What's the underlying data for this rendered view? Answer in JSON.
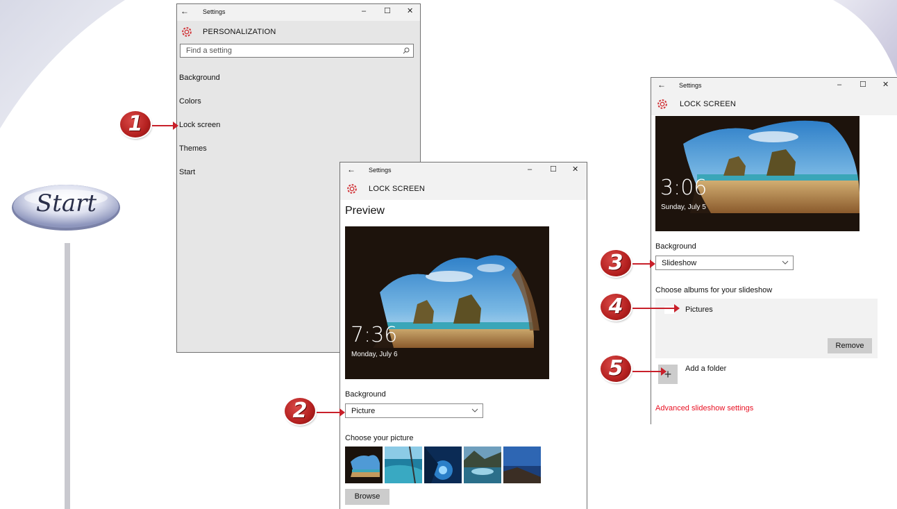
{
  "start_label": "Start",
  "win1": {
    "title": "Settings",
    "header": "PERSONALIZATION",
    "search_placeholder": "Find a setting",
    "nav": [
      "Background",
      "Colors",
      "Lock screen",
      "Themes",
      "Start"
    ]
  },
  "win2": {
    "title": "Settings",
    "header": "LOCK SCREEN",
    "preview_heading": "Preview",
    "time": "7:36",
    "date": "Monday, July 6",
    "background_label": "Background",
    "background_value": "Picture",
    "choose_label": "Choose your picture",
    "browse_label": "Browse"
  },
  "win3": {
    "title": "Settings",
    "header": "LOCK SCREEN",
    "time": "3:06",
    "date": "Sunday, July 5",
    "background_label": "Background",
    "background_value": "Slideshow",
    "albums_label": "Choose albums for your slideshow",
    "album_item": "Pictures",
    "remove_label": "Remove",
    "add_folder_label": "Add a folder",
    "advanced_link": "Advanced slideshow settings"
  },
  "window_controls": {
    "minimize": "–",
    "maximize": "☐",
    "close": "✕",
    "back": "←"
  },
  "steps": [
    "1",
    "2",
    "3",
    "4",
    "5"
  ],
  "colors": {
    "accent_red": "#c8202a",
    "link_red": "#e81123",
    "pane_gray": "#e6e6e6",
    "title_gray": "#f2f2f2"
  },
  "icons": [
    "gear-icon",
    "search-icon",
    "back-arrow-icon",
    "chevron-down-icon",
    "plus-icon"
  ]
}
